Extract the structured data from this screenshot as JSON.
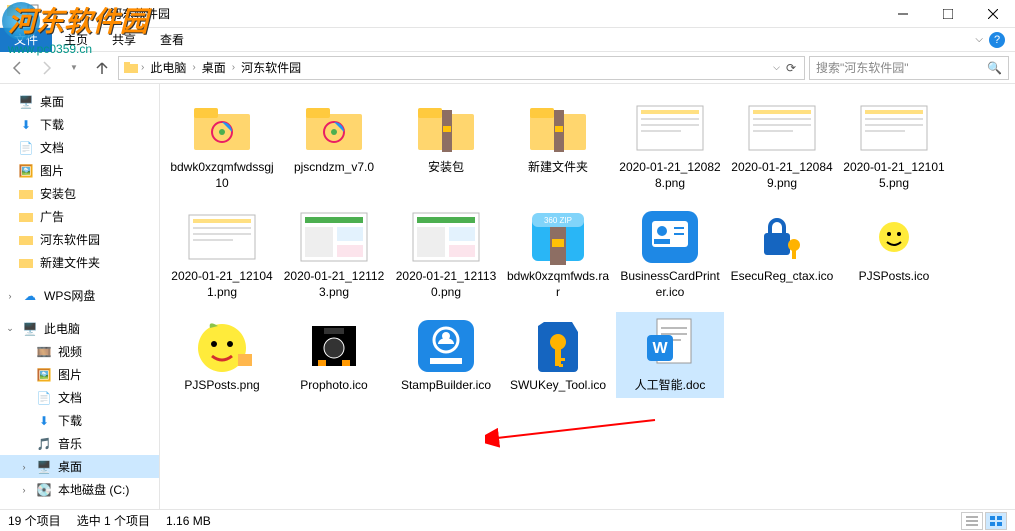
{
  "window": {
    "title": "河东软件园",
    "tabs": {
      "file": "文件",
      "home": "主页",
      "share": "共享",
      "view": "查看"
    }
  },
  "watermark": {
    "text": "河东软件园",
    "url": "www.pc0359.cn"
  },
  "breadcrumb": {
    "pc": "此电脑",
    "desktop": "桌面",
    "folder": "河东软件园"
  },
  "search": {
    "placeholder": "搜索\"河东软件园\""
  },
  "nav": {
    "desktop": "桌面",
    "downloads": "下载",
    "documents": "文档",
    "pictures": "图片",
    "pkg": "安装包",
    "ads": "广告",
    "hd": "河东软件园",
    "newfolder": "新建文件夹",
    "wps": "WPS网盘",
    "thispc": "此电脑",
    "video": "视频",
    "pictures2": "图片",
    "documents2": "文档",
    "downloads2": "下载",
    "music": "音乐",
    "desktop2": "桌面",
    "localdisk": "本地磁盘 (C:)"
  },
  "files": [
    {
      "name": "bdwk0xzqmfwdssgj10",
      "type": "folder"
    },
    {
      "name": "pjscndzm_v7.0",
      "type": "folder"
    },
    {
      "name": "安装包",
      "type": "folder"
    },
    {
      "name": "新建文件夹",
      "type": "folder"
    },
    {
      "name": "2020-01-21_120828.png",
      "type": "screenshot"
    },
    {
      "name": "2020-01-21_120849.png",
      "type": "screenshot"
    },
    {
      "name": "2020-01-21_121015.png",
      "type": "screenshot"
    },
    {
      "name": "2020-01-21_121041.png",
      "type": "screenshot"
    },
    {
      "name": "2020-01-21_121123.png",
      "type": "screenshot-full"
    },
    {
      "name": "2020-01-21_121130.png",
      "type": "screenshot-full"
    },
    {
      "name": "bdwk0xzqmfwds.rar",
      "type": "archive"
    },
    {
      "name": "BusinessCardPrinter.ico",
      "type": "app-card"
    },
    {
      "name": "EsecuReg_ctax.ico",
      "type": "app-lock"
    },
    {
      "name": "PJSPosts.ico",
      "type": "emoji-small"
    },
    {
      "name": "PJSPosts.png",
      "type": "emoji-big"
    },
    {
      "name": "Prophoto.ico",
      "type": "camera"
    },
    {
      "name": "StampBuilder.ico",
      "type": "stamp"
    },
    {
      "name": "SWUKey_Tool.ico",
      "type": "key"
    },
    {
      "name": "人工智能.doc",
      "type": "doc",
      "selected": true
    }
  ],
  "status": {
    "count": "19 个项目",
    "selected": "选中 1 个项目",
    "size": "1.16 MB"
  }
}
